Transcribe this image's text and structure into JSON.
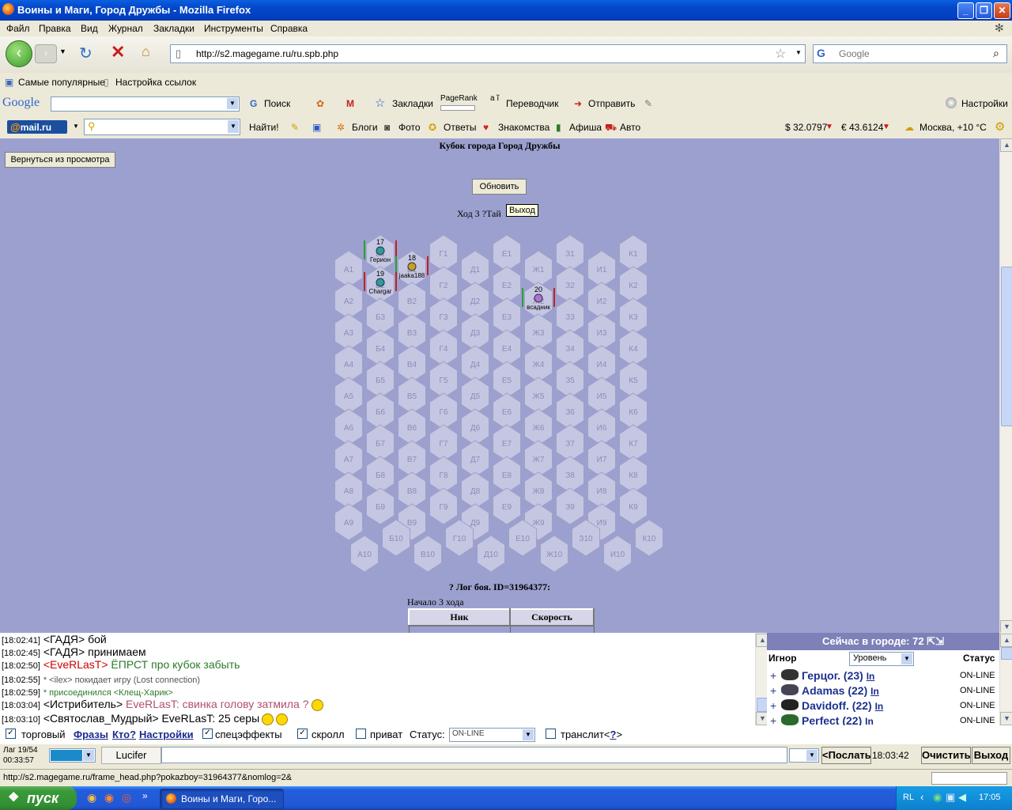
{
  "window": {
    "title": "Воины и Маги, Город Дружбы - Mozilla Firefox"
  },
  "menu": [
    "Файл",
    "Правка",
    "Вид",
    "Журнал",
    "Закладки",
    "Инструменты",
    "Справка"
  ],
  "nav": {
    "url": "http://s2.magegame.ru/ru.spb.php",
    "search_placeholder": "Google"
  },
  "bookmarks": [
    "Самые популярные",
    "Настройка ссылок"
  ],
  "google_toolbar": {
    "logo": "Google",
    "search": "Поиск",
    "bookmarks": "Закладки",
    "pagerank": "PageRank",
    "translator": "Переводчик",
    "send": "Отправить",
    "settings": "Настройки"
  },
  "mail_toolbar": {
    "logo_at": "@",
    "logo_text": "mail.ru",
    "find": "Найти!",
    "blogs": "Блоги",
    "photo": "Фото",
    "answers": "Ответы",
    "dating": "Знакомства",
    "afisha": "Афиша",
    "auto": "Авто",
    "usd": "$ 32.0797",
    "eur": "€ 43.6124",
    "weather": "Москва, +10 °C"
  },
  "game": {
    "cup_title": "Кубок города Город Дружбы",
    "back_button": "Вернуться из просмотра",
    "refresh_button": "Обновить",
    "turn_text": "Ход 3 ?Тай",
    "tooltip": "Выход",
    "board": {
      "columns": [
        "А",
        "Б",
        "В",
        "Г",
        "Д",
        "Е",
        "Ж",
        "З",
        "И",
        "К"
      ],
      "rows": 10,
      "units": [
        {
          "num": "17",
          "name": "Герион",
          "cell": "Б1",
          "color": "green"
        },
        {
          "num": "18",
          "name": "jaaka188",
          "cell": "В1",
          "color": "green"
        },
        {
          "num": "19",
          "name": "Chargar",
          "cell": "Б2",
          "color": "red"
        },
        {
          "num": "20",
          "name": "всадник",
          "cell": "Ж2",
          "color": "green"
        }
      ]
    },
    "log_title": "? Лог боя. ID=31964377:",
    "log_start": "Начало 3 хода",
    "log_headers": [
      "Ник",
      "Скорость"
    ]
  },
  "chat": [
    {
      "time": "[18:02:41]",
      "nick": "<ГАДЯ>",
      "text": " бой",
      "nick_color": "#000000",
      "text_color": "#000000"
    },
    {
      "time": "[18:02:45]",
      "nick": "<ГАДЯ>",
      "text": " принимаем",
      "nick_color": "#000000",
      "text_color": "#000000"
    },
    {
      "time": "[18:02:50]",
      "nick": "<EveRLasT>",
      "text": " ЁПРСТ про кубок забыть",
      "nick_color": "#cc0000",
      "text_color": "#2b7a2b"
    },
    {
      "time": "[18:02:55]",
      "nick": "* <ilex>",
      "text": " покидает игру (Lost connection)",
      "nick_color": "#555555",
      "text_color": "#555555"
    },
    {
      "time": "[18:02:59]",
      "nick": "* присоединился",
      "text": " <Клещ-Харик>",
      "nick_color": "#2b7a2b",
      "text_color": "#2b7a2b"
    },
    {
      "time": "[18:03:04]",
      "nick": "<Истрибитель>",
      "text": " EveRLasT: свинка голову затмила ?",
      "nick_color": "#000000",
      "text_color": "#b0506e"
    },
    {
      "time": "[18:03:10]",
      "nick": "<Святослав_Мудрый>",
      "text": " EveRLasT: 25 серы",
      "nick_color": "#000000",
      "text_color": "#000000"
    }
  ],
  "online": {
    "header": "Сейчас в городе: 72",
    "ignore": "Игнор",
    "sort": "Уровень",
    "status": "Статус",
    "players": [
      {
        "name": "Герцог. (23)",
        "link": "In",
        "status": "ON-LINE"
      },
      {
        "name": "Adamas (22)",
        "link": "In",
        "status": "ON-LINE"
      },
      {
        "name": "Davidoff. (22)",
        "link": "In",
        "status": "ON-LINE"
      },
      {
        "name": "Perfect (22)",
        "link": "In",
        "status": "ON-LINE"
      }
    ]
  },
  "controls": {
    "trade": "торговый",
    "phrases": "Фразы",
    "who": "Кто?",
    "settings": "Настройки",
    "effects": "спецэффекты",
    "scroll": "скролл",
    "private": "приват",
    "status_label": "Статус:",
    "status_value": "ON-LINE",
    "translit": "транслит<",
    "translit_q": "?",
    "translit_end": ">",
    "lag": "Лаг 19/54",
    "timer": "00:33:57",
    "nick": "Lucifer",
    "send": "<Послать",
    "clock": "18:03:42",
    "clear": "Очистить",
    "exit": "Выход"
  },
  "statusbar": {
    "url": "http://s2.magegame.ru/frame_head.php?pokazboy=31964377&nomlog=2&"
  },
  "taskbar": {
    "start": "пуск",
    "item": "Воины и Маги, Горо...",
    "lang": "RL",
    "time": "17:05"
  }
}
